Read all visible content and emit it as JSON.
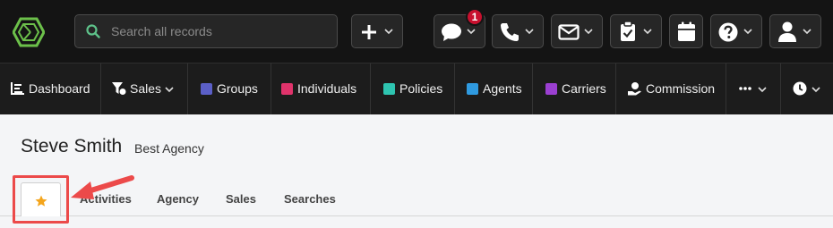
{
  "header": {
    "search_placeholder": "Search all records",
    "notification_count": "1",
    "icons": [
      "logo-hexagon-icon",
      "search-icon",
      "plus-icon",
      "chat-icon",
      "phone-icon",
      "mail-icon",
      "clipboard-check-icon",
      "calendar-icon",
      "help-icon",
      "user-icon"
    ]
  },
  "nav": {
    "items": [
      {
        "label": "Dashboard",
        "icon": "dashboard-chart-icon"
      },
      {
        "label": "Sales",
        "icon": "filter-dollar-icon"
      },
      {
        "label": "Groups",
        "color": "#5b5fc7"
      },
      {
        "label": "Individuals",
        "color": "#e0336b"
      },
      {
        "label": "Policies",
        "color": "#2ec4b0"
      },
      {
        "label": "Agents",
        "color": "#2f9ae0"
      },
      {
        "label": "Carriers",
        "color": "#9b3fd1"
      },
      {
        "label": "Commission",
        "icon": "hand-money-icon"
      }
    ],
    "more_icon": "ellipsis-icon",
    "history_icon": "clock-icon"
  },
  "record": {
    "name": "Steve Smith",
    "agency": "Best Agency"
  },
  "tabs": {
    "favorite_icon": "star-icon",
    "items": [
      "Activities",
      "Agency",
      "Sales",
      "Searches"
    ]
  }
}
